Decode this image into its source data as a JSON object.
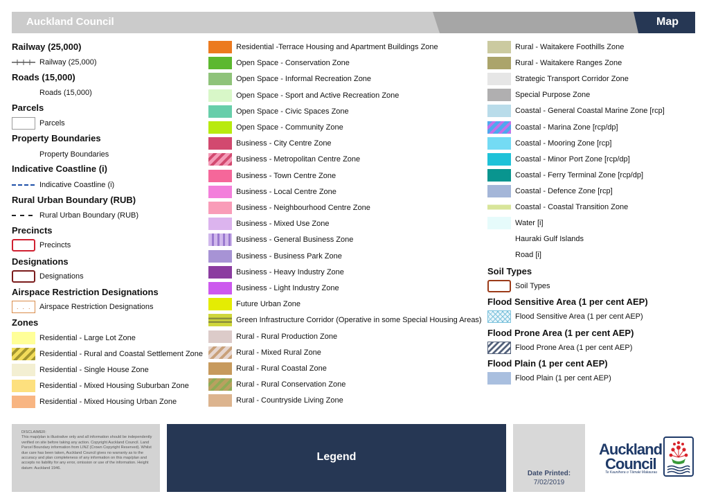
{
  "header": {
    "title": "Auckland Council",
    "tab": "Map"
  },
  "colors": {
    "header_light": "#cbcbcb",
    "header_mid": "#a6a6a6",
    "header_dark": "#263754",
    "footer_dark": "#263754"
  },
  "left": {
    "sections": [
      {
        "heading": "Railway  (25,000)",
        "items": [
          {
            "label": "Railway  (25,000)",
            "swatch": "railway"
          }
        ]
      },
      {
        "heading": "Roads  (15,000)",
        "items": [
          {
            "label": "Roads  (15,000)",
            "swatch": "none"
          }
        ]
      },
      {
        "heading": "Parcels",
        "items": [
          {
            "label": "Parcels",
            "swatch": "parcel"
          }
        ]
      },
      {
        "heading": "Property Boundaries",
        "items": [
          {
            "label": "Property Boundaries",
            "swatch": "none"
          }
        ]
      },
      {
        "heading": "Indicative Coastline (i)",
        "items": [
          {
            "label": "Indicative Coastline (i)",
            "swatch": "coastline"
          }
        ]
      },
      {
        "heading": "Rural Urban Boundary (RUB)",
        "items": [
          {
            "label": "Rural Urban Boundary (RUB)",
            "swatch": "rub"
          }
        ]
      },
      {
        "heading": "Precincts",
        "items": [
          {
            "label": "Precincts",
            "swatch": "precinct"
          }
        ]
      },
      {
        "heading": "Designations",
        "items": [
          {
            "label": "Designations",
            "swatch": "designation"
          }
        ]
      },
      {
        "heading": "Airspace Restriction Designations",
        "items": [
          {
            "label": "Airspace Restriction Designations",
            "swatch": "airspace"
          }
        ]
      },
      {
        "heading": "Zones",
        "items": [
          {
            "label": "Residential - Large Lot Zone",
            "swatch": "solid",
            "color": "#ffff99"
          },
          {
            "label": "Residential - Rural and Coastal Settlement Zone",
            "swatch": "hatch",
            "color": "#f2dc5a",
            "color2": "#a3962f"
          },
          {
            "label": "Residential - Single House Zone",
            "swatch": "solid",
            "color": "#f3efd2"
          },
          {
            "label": "Residential - Mixed Housing Suburban Zone",
            "swatch": "solid",
            "color": "#fde07e"
          },
          {
            "label": "Residential - Mixed Housing Urban Zone",
            "swatch": "solid",
            "color": "#f8b582"
          }
        ]
      }
    ]
  },
  "middle": {
    "items": [
      {
        "label": "Residential -Terrace Housing and Apartment Buildings Zone",
        "swatch": "solid",
        "color": "#ec7a1f"
      },
      {
        "label": "Open Space - Conservation Zone",
        "swatch": "solid",
        "color": "#5cb82f"
      },
      {
        "label": "Open Space - Informal Recreation Zone",
        "swatch": "solid",
        "color": "#8fc37a"
      },
      {
        "label": "Open Space - Sport and Active Recreation Zone",
        "swatch": "solid",
        "color": "#d8f7c8"
      },
      {
        "label": "Open Space - Civic Spaces Zone",
        "swatch": "solid",
        "color": "#67ceaa"
      },
      {
        "label": "Open Space - Community Zone",
        "swatch": "solid",
        "color": "#b8ea0e"
      },
      {
        "label": "Business - City Centre Zone",
        "swatch": "solid",
        "color": "#d2496f"
      },
      {
        "label": "Business - Metropolitan Centre Zone",
        "swatch": "hatch",
        "color": "#f49ab7",
        "color2": "#d2496f"
      },
      {
        "label": "Business - Town Centre Zone",
        "swatch": "solid",
        "color": "#f5679a"
      },
      {
        "label": "Business - Local Centre Zone",
        "swatch": "solid",
        "color": "#f37fdb"
      },
      {
        "label": "Business - Neighbourhood Centre Zone",
        "swatch": "solid",
        "color": "#f99cb8"
      },
      {
        "label": "Business - Mixed Use Zone",
        "swatch": "solid",
        "color": "#dcb4ee"
      },
      {
        "label": "Business - General Business Zone",
        "swatch": "stripes",
        "color": "#d0b8ec",
        "color2": "#9a79cf"
      },
      {
        "label": "Business - Business Park Zone",
        "swatch": "solid",
        "color": "#a793d5"
      },
      {
        "label": "Business - Heavy Industry Zone",
        "swatch": "solid",
        "color": "#8b3ca0"
      },
      {
        "label": "Business - Light Industry Zone",
        "swatch": "solid",
        "color": "#cc59ee"
      },
      {
        "label": "Future Urban Zone",
        "swatch": "solid",
        "color": "#e4ec03"
      },
      {
        "label": "Green Infrastructure Corridor (Operative in some Special Housing Areas)",
        "swatch": "bands",
        "color": "#cfd63a",
        "color2": "#8a8e3a"
      },
      {
        "label": "Rural - Rural Production Zone",
        "swatch": "solid",
        "color": "#dccbc9"
      },
      {
        "label": "Rural - Mixed Rural Zone",
        "swatch": "hatch",
        "color": "#e6d6cf",
        "color2": "#c9a17a"
      },
      {
        "label": "Rural - Rural Coastal Zone",
        "swatch": "solid",
        "color": "#c79a5d"
      },
      {
        "label": "Rural - Rural Conservation Zone",
        "swatch": "hatch",
        "color": "#b9a060",
        "color2": "#8eac55"
      },
      {
        "label": "Rural - Countryside Living Zone",
        "swatch": "solid",
        "color": "#dcb48e"
      }
    ]
  },
  "right": {
    "items": [
      {
        "label": "Rural - Waitakere Foothills Zone",
        "swatch": "solid",
        "color": "#cbcaa0"
      },
      {
        "label": "Rural - Waitakere Ranges Zone",
        "swatch": "solid",
        "color": "#aba46b"
      },
      {
        "label": "Strategic Transport Corridor Zone",
        "swatch": "solid",
        "color": "#e6e6e6"
      },
      {
        "label": "Special Purpose Zone",
        "swatch": "solid",
        "color": "#b0afb0"
      },
      {
        "label": "Coastal - General Coastal Marine Zone [rcp]",
        "swatch": "solid",
        "color": "#b9dcea"
      },
      {
        "label": "Coastal - Marina Zone [rcp/dp]",
        "swatch": "hatch",
        "color": "#4fa8ee",
        "color2": "#c46fe8"
      },
      {
        "label": "Coastal - Mooring Zone [rcp]",
        "swatch": "solid",
        "color": "#74dbf4"
      },
      {
        "label": "Coastal - Minor Port Zone [rcp/dp]",
        "swatch": "solid",
        "color": "#1fc2d8"
      },
      {
        "label": "Coastal - Ferry Terminal Zone [rcp/dp]",
        "swatch": "solid",
        "color": "#09958f"
      },
      {
        "label": "Coastal - Defence Zone [rcp]",
        "swatch": "solid",
        "color": "#a4b6d8"
      },
      {
        "label": "Coastal - Coastal Transition Zone",
        "swatch": "band",
        "color": "#d8e59a"
      },
      {
        "label": "Water [i]",
        "swatch": "solid",
        "color": "#e6fbfb"
      },
      {
        "label": "Hauraki Gulf Islands",
        "swatch": "none"
      },
      {
        "label": "Road [i]",
        "swatch": "none"
      }
    ],
    "sections": [
      {
        "heading": "Soil Types",
        "items": [
          {
            "label": "Soil Types",
            "swatch": "soil"
          }
        ]
      },
      {
        "heading": "Flood Sensitive Area (1 per cent AEP)",
        "items": [
          {
            "label": "Flood Sensitive Area (1 per cent AEP)",
            "swatch": "crosshatch",
            "color": "#eaf6fb",
            "color2": "#7cc2dc"
          }
        ]
      },
      {
        "heading": "Flood Prone Area (1 per cent AEP)",
        "items": [
          {
            "label": "Flood Prone Area (1 per cent AEP)",
            "swatch": "diag",
            "color": "#ffffff",
            "color2": "#55637c"
          }
        ]
      },
      {
        "heading": "Flood Plain (1 per cent AEP)",
        "items": [
          {
            "label": "Flood Plain (1 per cent AEP)",
            "swatch": "solid",
            "color": "#a9bfdf"
          }
        ]
      }
    ]
  },
  "footer": {
    "disclaimer": "DISCLAIMER:\nThis map/plan is illustrative only and all information should be independently verified on site before taking any action. Copyright Auckland Council. Land Parcel Boundary information from LINZ (Crown Copyright Reserved). Whilst due care has been taken, Auckland Council gives no warranty as to the accuracy and plan completeness of any information on this map/plan and accepts no liability for any error, omission or use of the information. Height datum: Auckland 1946.",
    "legend": "Legend",
    "date_label": "Date Printed:",
    "date_value": "7/02/2019",
    "logo_line1": "Auckland",
    "logo_line2": "Council",
    "logo_tagline": "Te Kaunihera o Tāmaki Makaurau"
  }
}
